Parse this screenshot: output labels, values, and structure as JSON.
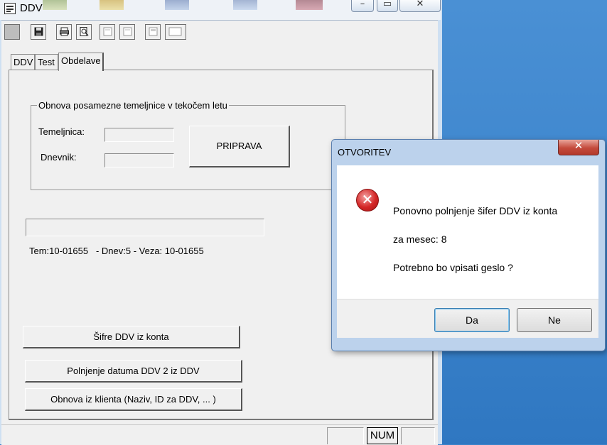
{
  "colors": {
    "desktop": "#3c84cc",
    "dialog_frame": "#bcd2ec",
    "close_red": "#c44a3c",
    "error_red": "#d42626"
  },
  "window": {
    "title": "DDV"
  },
  "toolbar": {
    "icons": [
      "toolbar-blank-icon",
      "save-icon",
      "print-icon",
      "print-preview-icon",
      "page-icon",
      "page-copy-icon",
      "page-icon",
      "page-blank-icon"
    ]
  },
  "tabs": [
    {
      "label": "DDV"
    },
    {
      "label": "Test"
    },
    {
      "label": "Obdelave",
      "active": true
    }
  ],
  "group": {
    "title": "Obnova posamezne temeljnice v tekočem letu",
    "temeljnica_label": "Temeljnica:",
    "temeljnica_value": "",
    "dnevnik_label": "Dnevnik:",
    "dnevnik_value": "",
    "pripava_button": "PRIPRAVA"
  },
  "progress_value": 0,
  "info_text": "Tem:10-01655   - Dnev:5 - Veza: 10-01655",
  "buttons": {
    "sifre": "Šifre DDV iz konta",
    "polnjenje": "Polnjenje datuma DDV 2 iz DDV",
    "obnova": "Obnova iz klienta (Naziv, ID za DDV, ... )"
  },
  "status": {
    "num": "NUM"
  },
  "dialog": {
    "title": "OTVORITEV",
    "icon": "error-icon",
    "line1": "Ponovno polnjenje šifer DDV iz konta",
    "line2": "za mesec: 8",
    "line3": "Potrebno bo vpisati geslo ?",
    "yes": "Da",
    "no": "Ne"
  }
}
